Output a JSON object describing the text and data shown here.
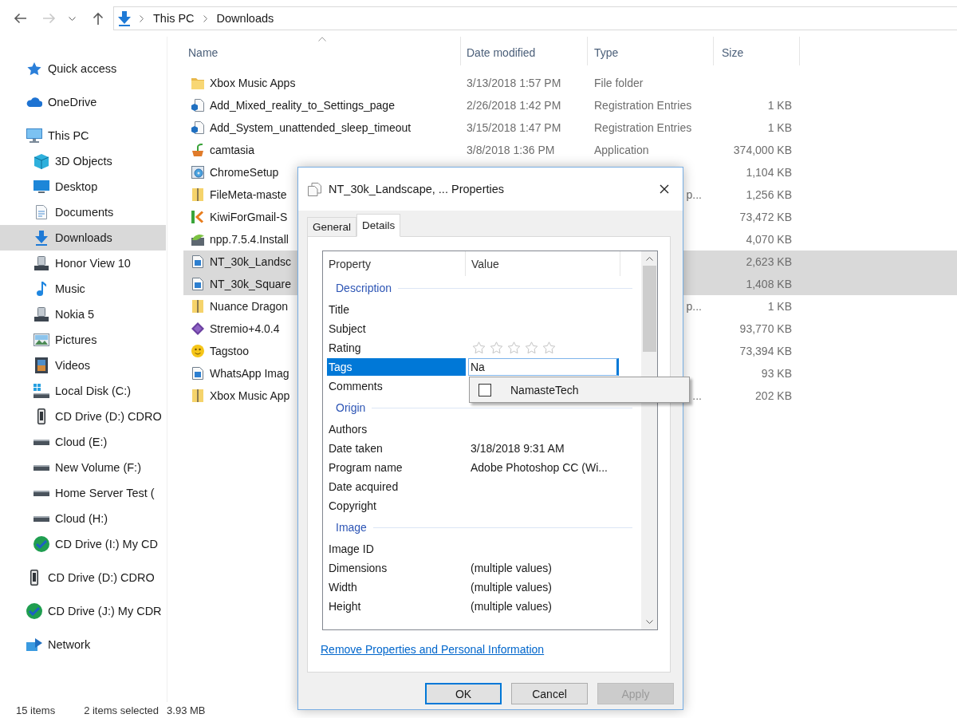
{
  "nav": {
    "buttons": [
      {
        "kind": "back",
        "disabled": false
      },
      {
        "kind": "forward",
        "disabled": true
      },
      {
        "kind": "recent",
        "disabled": false
      },
      {
        "kind": "up",
        "disabled": false
      }
    ],
    "breadcrumb": [
      "This PC",
      "Downloads"
    ]
  },
  "sidebar": {
    "items": [
      {
        "label": "Quick access",
        "kind": "star",
        "selected": false
      },
      {
        "label": "OneDrive",
        "kind": "cloud",
        "selected": false
      },
      {
        "label": "This PC",
        "kind": "pc",
        "selected": false,
        "children": [
          {
            "label": "3D Objects",
            "kind": "cube",
            "selected": false
          },
          {
            "label": "Desktop",
            "kind": "desktop",
            "selected": false
          },
          {
            "label": "Documents",
            "kind": "document",
            "selected": false
          },
          {
            "label": "Downloads",
            "kind": "download",
            "selected": true
          },
          {
            "label": "Honor View 10",
            "kind": "device",
            "selected": false
          },
          {
            "label": "Music",
            "kind": "music",
            "selected": false
          },
          {
            "label": "Nokia 5",
            "kind": "device",
            "selected": false
          },
          {
            "label": "Pictures",
            "kind": "pictures",
            "selected": false
          },
          {
            "label": "Videos",
            "kind": "videos",
            "selected": false
          },
          {
            "label": "Local Disk (C:)",
            "kind": "system",
            "selected": false
          },
          {
            "label": "CD Drive (D:) CDRO",
            "kind": "cdrom",
            "selected": false
          },
          {
            "label": "Cloud (E:)",
            "kind": "drive",
            "selected": false
          },
          {
            "label": "New Volume (F:)",
            "kind": "drive",
            "selected": false
          },
          {
            "label": "Home Server Test (",
            "kind": "drive",
            "selected": false
          },
          {
            "label": "Cloud (H:)",
            "kind": "drive",
            "selected": false
          },
          {
            "label": "CD Drive (I:) My CD",
            "kind": "disc",
            "selected": false
          }
        ]
      },
      {
        "label": "CD Drive (D:) CDRO",
        "kind": "cdrom",
        "selected": false
      },
      {
        "label": "CD Drive (J:) My CDR",
        "kind": "disc",
        "selected": false
      },
      {
        "label": "Network",
        "kind": "network",
        "selected": false
      }
    ]
  },
  "file_list": {
    "columns": [
      {
        "label": "Name",
        "sorted": true
      },
      {
        "label": "Date modified",
        "sorted": false
      },
      {
        "label": "Type",
        "sorted": false
      },
      {
        "label": "Size",
        "sorted": false
      }
    ],
    "rows": [
      {
        "name": "Xbox Music Apps",
        "kind": "folder",
        "date": "3/13/2018 1:57 PM",
        "type": "File folder",
        "selected": false
      },
      {
        "name": "Add_Mixed_reality_to_Settings_page",
        "kind": "registry",
        "date": "2/26/2018 1:42 PM",
        "type": "Registration Entries",
        "size": "1 KB",
        "selected": false
      },
      {
        "name": "Add_System_unattended_sleep_timeout",
        "kind": "registry",
        "date": "3/15/2018 1:47 PM",
        "type": "Registration Entries",
        "size": "1 KB",
        "selected": false
      },
      {
        "name": "camtasia",
        "kind": "pot",
        "date": "3/8/2018 1:36 PM",
        "type": "Application",
        "size": "374,000 KB",
        "selected": false
      },
      {
        "name": "ChromeSetup",
        "kind": "setup",
        "size": "1,104 KB",
        "selected": false
      },
      {
        "name": "FileMeta-maste",
        "kind": "zip",
        "type_tail": "p...",
        "size": "1,256 KB",
        "selected": false
      },
      {
        "name": "KiwiForGmail-S",
        "kind": "chevron",
        "size": "73,472 KB",
        "selected": false
      },
      {
        "name": "npp.7.5.4.Install",
        "kind": "leaf",
        "size": "4,070 KB",
        "selected": false
      },
      {
        "name": "NT_30k_Landsc",
        "kind": "image",
        "size": "2,623 KB",
        "selected": true
      },
      {
        "name": "NT_30k_Square",
        "kind": "image",
        "size": "1,408 KB",
        "selected": true
      },
      {
        "name": "Nuance Dragon",
        "kind": "zip",
        "type_tail": "p...",
        "size": "1 KB",
        "selected": false
      },
      {
        "name": "Stremio+4.0.4",
        "kind": "diamond",
        "size": "93,770 KB",
        "selected": false
      },
      {
        "name": "Tagstoo",
        "kind": "smiley",
        "size": "73,394 KB",
        "selected": false
      },
      {
        "name": "WhatsApp Imag",
        "kind": "image",
        "size": "93 KB",
        "selected": false
      },
      {
        "name": "Xbox Music App",
        "kind": "zip",
        "type_tail": "...",
        "size": "202 KB",
        "selected": false
      }
    ]
  },
  "status_bar": {
    "item_count": "15 items",
    "selection": "2 items selected",
    "selection_size": "3.93 MB"
  },
  "dialog": {
    "title": "NT_30k_Landscape, ... Properties",
    "tabs": [
      {
        "label": "General",
        "selected": false
      },
      {
        "label": "Details",
        "selected": true
      }
    ],
    "columns": [
      "Property",
      "Value"
    ],
    "groups": [
      {
        "heading": "Description",
        "rows": [
          {
            "property": "Title",
            "kind": "text",
            "selected": false
          },
          {
            "property": "Subject",
            "kind": "text",
            "selected": false
          },
          {
            "property": "Rating",
            "kind": "rating",
            "stars": 0,
            "selected": false
          },
          {
            "property": "Tags",
            "kind": "edit",
            "value": "Na",
            "selected": true
          },
          {
            "property": "Comments",
            "kind": "text",
            "selected": false
          }
        ]
      },
      {
        "heading": "Origin",
        "rows": [
          {
            "property": "Authors",
            "kind": "text",
            "selected": false
          },
          {
            "property": "Date taken",
            "kind": "text",
            "value": "3/18/2018 9:31 AM",
            "selected": false
          },
          {
            "property": "Program name",
            "kind": "text",
            "value": "Adobe Photoshop CC (Wi...",
            "selected": false
          },
          {
            "property": "Date acquired",
            "kind": "text",
            "selected": false
          },
          {
            "property": "Copyright",
            "kind": "text",
            "selected": false
          }
        ]
      },
      {
        "heading": "Image",
        "rows": [
          {
            "property": "Image ID",
            "kind": "text",
            "selected": false
          },
          {
            "property": "Dimensions",
            "kind": "text",
            "value": "(multiple values)",
            "selected": false
          },
          {
            "property": "Width",
            "kind": "text",
            "value": "(multiple values)",
            "selected": false
          },
          {
            "property": "Height",
            "kind": "text",
            "value": "(multiple values)",
            "selected": false
          }
        ]
      }
    ],
    "suggestions": [
      {
        "label": "NamasteTech",
        "checked": false
      }
    ],
    "link": "Remove Properties and Personal Information",
    "buttons": [
      {
        "label": "OK",
        "default": true,
        "disabled": false
      },
      {
        "label": "Cancel",
        "default": false,
        "disabled": false
      },
      {
        "label": "Apply",
        "default": false,
        "disabled": true
      }
    ]
  }
}
